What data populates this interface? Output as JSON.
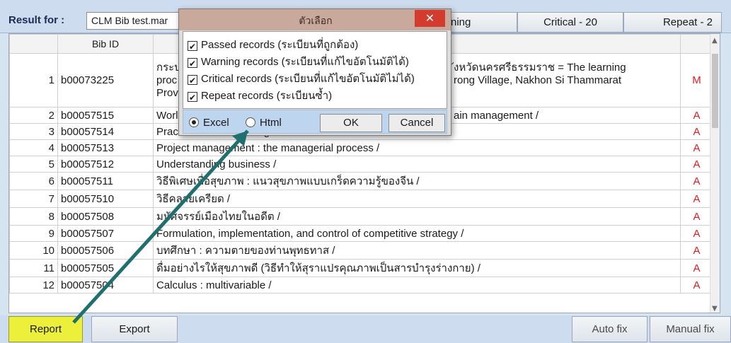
{
  "toolbar": {
    "result_label": "Result for :",
    "result_value": "CLM Bib test.mar",
    "tabs": [
      "ning",
      "Critical - 20",
      "Repeat - 2"
    ]
  },
  "grid": {
    "headers": [
      "",
      "Bib ID",
      "",
      ""
    ],
    "rows": [
      {
        "n": "1",
        "id": "b00073225",
        "title_lines": [
          "กระบ",
          "proc",
          "Prov"
        ],
        "title_right": [
          "ังหวัดนครศรีธรรมราช =  The learning",
          "rong Village, Nakhon Si Thammarat",
          ""
        ],
        "code": "M"
      },
      {
        "n": "2",
        "id": "b00057515",
        "title": "Worl",
        "title_right": "ain management /",
        "code": "A"
      },
      {
        "n": "3",
        "id": "b00057514",
        "title": "Practical finance management /",
        "code": "A"
      },
      {
        "n": "4",
        "id": "b00057513",
        "title": "Project management :   the managerial process /",
        "code": "A"
      },
      {
        "n": "5",
        "id": "b00057512",
        "title": "Understanding business /",
        "code": "A"
      },
      {
        "n": "6",
        "id": "b00057511",
        "title": "วิธีพิเศษเพื่อสุขภาพ :  แนวสุขภาพแบบเกร็ดความรู้ของจีน /",
        "code": "A"
      },
      {
        "n": "7",
        "id": "b00057510",
        "title": "วิธีคลายเครียด /",
        "code": "A"
      },
      {
        "n": "8",
        "id": "b00057508",
        "title": "มหัศจรรย์เมืองไทยในอดีต /",
        "code": "A"
      },
      {
        "n": "9",
        "id": "b00057507",
        "title": "Formulation, implementation, and control of competitive strategy /",
        "code": "A"
      },
      {
        "n": "10",
        "id": "b00057506",
        "title": "บทศึกษา :  ความตายของท่านพุทธทาส /",
        "code": "A"
      },
      {
        "n": "11",
        "id": "b00057505",
        "title": "ดื่มอย่างไรให้สุขภาพดี (วิธีทำให้สุราแปรคุณภาพเป็นสารบำรุงร่างกาย) /",
        "code": "A"
      },
      {
        "n": "12",
        "id": "b00057504",
        "title": "Calculus :  multivariable /",
        "code": "A"
      }
    ]
  },
  "bottom": {
    "report": "Report",
    "export": "Export",
    "autofix": "Auto fix",
    "manualfix": "Manual fix"
  },
  "dialog": {
    "title": "ตัวเลือก",
    "close": "✕",
    "options": [
      {
        "label": "Passed records (ระเบียนที่ถูกต้อง)",
        "checked": true
      },
      {
        "label": "Warning records (ระเบียนที่แก้ไขอัตโนมัติได้)",
        "checked": true
      },
      {
        "label": "Critical records (ระเบียนที่แก้ไขอัตโนมัติไม่ได้)",
        "checked": true
      },
      {
        "label": "Repeat records (ระเบียนซ้ำ)",
        "checked": true
      }
    ],
    "formats": [
      {
        "label": "Excel",
        "selected": true
      },
      {
        "label": "Html",
        "selected": false
      }
    ],
    "ok": "OK",
    "cancel": "Cancel"
  },
  "colors": {
    "accent_arrow": "#1f6f6e",
    "report_button": "#ecf03a",
    "code_red": "#e21d1d"
  }
}
